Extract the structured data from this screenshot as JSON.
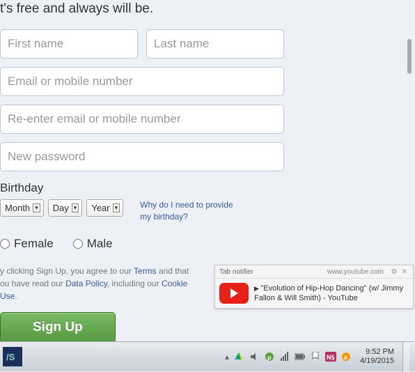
{
  "tagline": "t's free and always will be.",
  "form": {
    "first_name_ph": "First name",
    "last_name_ph": "Last name",
    "email_ph": "Email or mobile number",
    "reemail_ph": "Re-enter email or mobile number",
    "password_ph": "New password"
  },
  "birthday": {
    "label": "Birthday",
    "month": "Month",
    "day": "Day",
    "year": "Year",
    "why_line1": "Why do I need to provide",
    "why_line2": "my birthday?"
  },
  "gender": {
    "female": "Female",
    "male": "Male"
  },
  "terms": {
    "t1": "y clicking Sign Up, you agree to our ",
    "terms": "Terms",
    "t2": " and that",
    "t3": "ou have read our ",
    "data_policy": "Data Policy",
    "t4": ", including our ",
    "cookie": "Cookie",
    "use": "Use",
    "period": "."
  },
  "signup": "Sign Up",
  "notifier": {
    "title": "Tab notifier",
    "domain": "www.youtube.com",
    "text": "\"Evolution of Hip-Hop Dancing\" (w/ Jimmy Fallon & Will Smith) - YouTube"
  },
  "clock": {
    "time": "9:52 PM",
    "date": "4/19/2015"
  }
}
